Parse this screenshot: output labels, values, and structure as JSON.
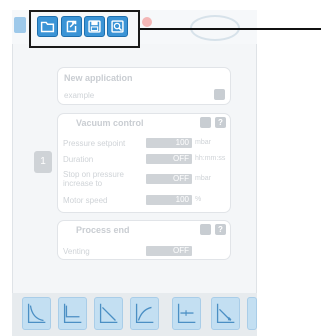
{
  "toolbar": {
    "items": [
      {
        "name": "open",
        "icon": "folder-icon"
      },
      {
        "name": "export",
        "icon": "export-icon"
      },
      {
        "name": "save",
        "icon": "save-icon"
      },
      {
        "name": "save-as",
        "icon": "save-as-icon"
      }
    ]
  },
  "application": {
    "title": "New application",
    "name_value": "example"
  },
  "vacuum_control": {
    "title": "Vacuum control",
    "step_number": "1",
    "rows": [
      {
        "label": "Pressure setpoint",
        "value": "100",
        "unit": "mbar"
      },
      {
        "label": "Duration",
        "value": "OFF",
        "unit": "hh:mm:ss"
      },
      {
        "label": "Stop on pressure increase to",
        "value": "OFF",
        "unit": "mbar"
      },
      {
        "label": "Motor speed",
        "value": "100",
        "unit": "%"
      }
    ]
  },
  "process_end": {
    "title": "Process end",
    "rows": [
      {
        "label": "Venting",
        "value": "OFF"
      }
    ]
  },
  "gear_symbol": "⚙",
  "help_symbol": "?",
  "colors": {
    "highlight_border": "#1a1a1a",
    "toolbar_icon": "#3b94d6",
    "faded_text": "#cfd3d7"
  }
}
